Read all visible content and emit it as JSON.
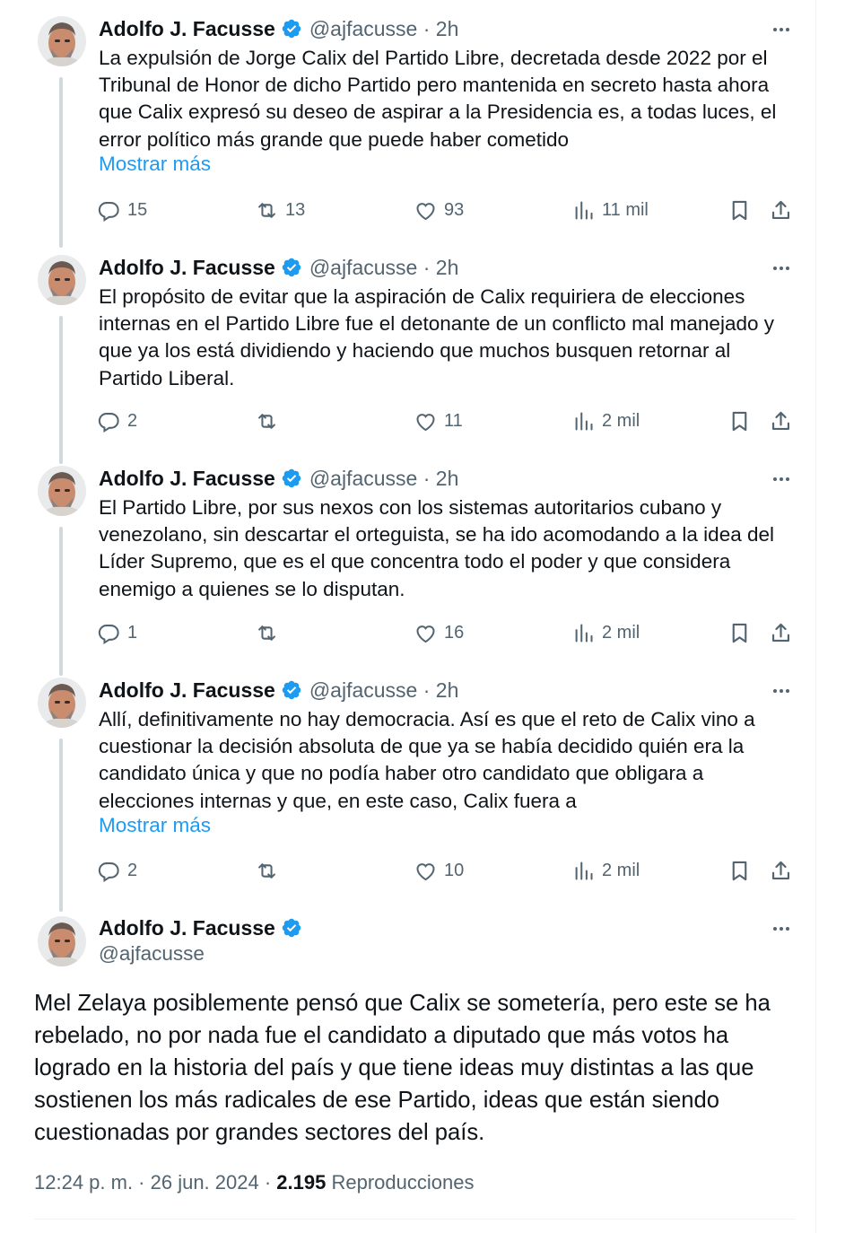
{
  "colors": {
    "accent": "#1d9bf0",
    "secondary_text": "#536471",
    "primary_text": "#0f1419",
    "connector": "#cfd9de"
  },
  "author": {
    "name": "Adolfo J. Facusse",
    "handle": "@ajfacusse",
    "verified_icon": "verified-badge-icon"
  },
  "tweets": [
    {
      "meta": "@ajfacusse · 2h",
      "lines": [
        "La expulsión de Jorge Calix del Partido Libre, decretada desde 2022 por el",
        "Tribunal de Honor de dicho Partido pero mantenida en secreto hasta ahora",
        "que Calix expresó su deseo de aspirar a la Presidencia es, a todas luces, el",
        "error político  más grande que puede haber cometido"
      ],
      "show_more": "Mostrar más",
      "replies": "15",
      "retweets": "13",
      "likes": "93",
      "views": "11 mil"
    },
    {
      "meta": "@ajfacusse · 2h",
      "lines": [
        "El propósito de evitar que la aspiración de Calix requiriera de elecciones",
        "internas en el Partido Libre fue el detonante de un conflicto mal manejado y",
        "que ya los está dividiendo y haciendo que muchos busquen retornar al",
        "Partido Liberal."
      ],
      "replies": "2",
      "retweets": "",
      "likes": "11",
      "views": "2 mil"
    },
    {
      "meta": "@ajfacusse · 2h",
      "lines": [
        "El Partido Libre, por sus nexos con los sistemas autoritarios cubano y",
        "venezolano, sin descartar el orteguista,  se ha ido acomodando a la idea del",
        "Líder Supremo, que es el que concentra todo el poder y que considera",
        "enemigo a quienes se lo disputan."
      ],
      "replies": "1",
      "retweets": "",
      "likes": "16",
      "views": "2 mil"
    },
    {
      "meta": "@ajfacusse · 2h",
      "lines": [
        "Allí, definitivamente no hay democracia. Así es que el reto de Calix vino a",
        "cuestionar la decisión absoluta de que ya se había decidido quién era la",
        "candidato única y que no podía haber otro candidato que obligara a",
        "elecciones internas y que, en este caso, Calix fuera a"
      ],
      "show_more": "Mostrar más",
      "replies": "2",
      "retweets": "",
      "likes": "10",
      "views": "2 mil"
    }
  ],
  "main_tweet": {
    "name": "Adolfo J. Facusse",
    "handle": "@ajfacusse",
    "lines": [
      "Mel Zelaya posiblemente pensó que Calix se sometería, pero este se ha",
      "rebelado, no por nada fue el candidato a diputado que más votos ha",
      "logrado en la historia del país y que tiene ideas muy distintas a las que",
      "sostienen los más radicales de ese Partido, ideas que están siendo",
      "cuestionadas por grandes sectores del país."
    ],
    "timestamp": "12:24 p. m. · 26 jun. 2024 · ",
    "views_count": "2.195",
    "views_label": " Reproducciones"
  }
}
